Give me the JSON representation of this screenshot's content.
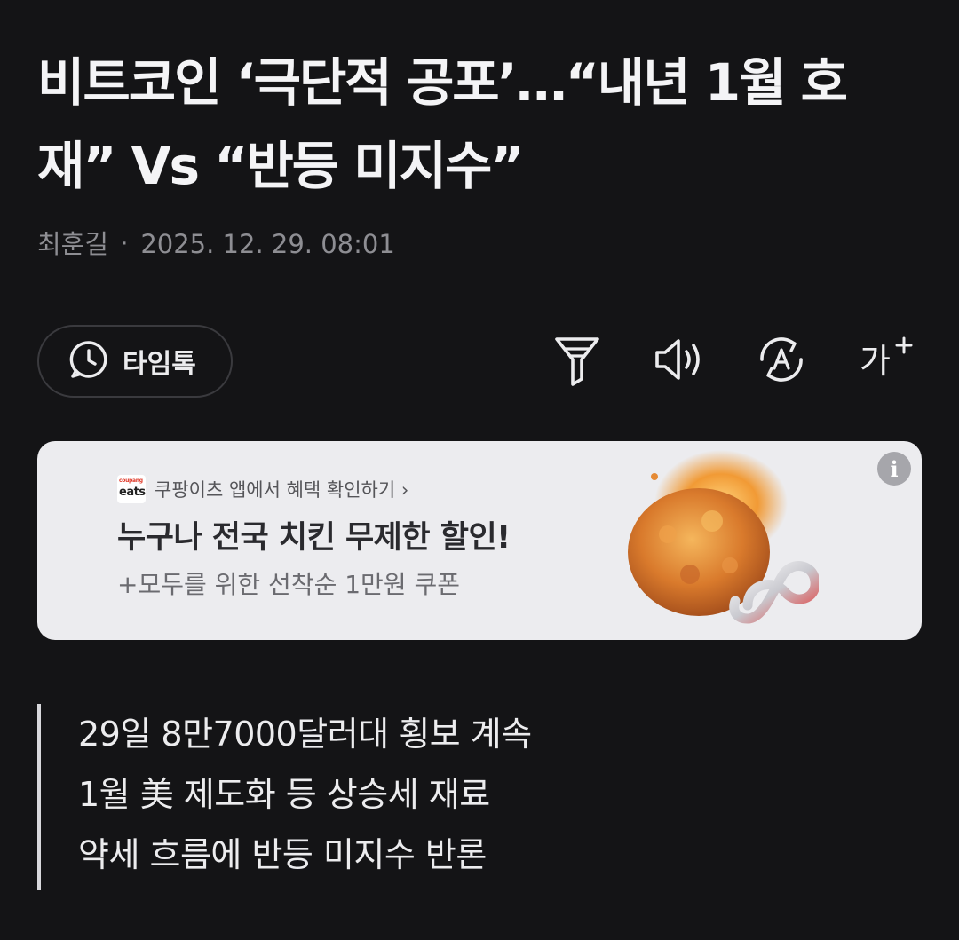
{
  "article": {
    "headline_line1": "비트코인 ‘극단적 공포’…“내년 1월 호",
    "headline_line2": "재” Vs “반등 미지수”",
    "author": "최훈길",
    "separator": "·",
    "date": "2025. 12. 29. 08:01"
  },
  "toolbar": {
    "timetalk_label": "타임톡",
    "font_size_label": "가",
    "icons": [
      "clock-chat-icon",
      "filter-icon",
      "speaker-icon",
      "auto-translate-icon",
      "font-size-plus-icon"
    ]
  },
  "ad": {
    "brand_logo_top": "coupang",
    "brand_logo_bottom": "eats",
    "brand_text": "쿠팡이츠 앱에서 혜택 확인하기 ›",
    "title": "누구나 전국 치킨 무제한 할인!",
    "subtitle": "+모두를 위한 선착순 1만원 쿠폰",
    "info_label": "i",
    "background_color": "#ececef"
  },
  "summary": {
    "lines": [
      "29일 8만7000달러대 횡보 계속",
      "1월 美 제도화 등 상승세 재료",
      "약세 흐름에 반등 미지수 반론"
    ]
  },
  "colors": {
    "background": "#141416",
    "text": "#f2f2f4",
    "meta": "#8e8e93"
  }
}
